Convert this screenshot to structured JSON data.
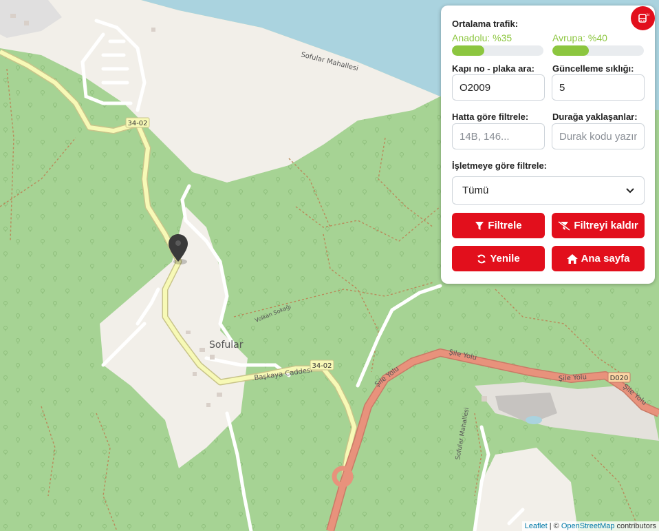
{
  "map": {
    "place_label": "Sofular",
    "neighborhood_label": "Sofular Mahallesi",
    "neighborhood_label_2": "Sofular Mahallesi",
    "road_badges": [
      "34-02",
      "34-02",
      "D020"
    ],
    "street_labels": {
      "baskaya": "Başkaya Caddesi",
      "volkan": "Volkan Sokağı",
      "sile1": "Şile Yolu",
      "sile2": "Şile Yolu",
      "sile3": "Şile Yolu",
      "sile4": "Şile Yolu"
    },
    "colors": {
      "forest": "#a6d394",
      "water": "#aad3df",
      "land": "#f2efe9",
      "primary_road": "#e8927c",
      "secondary_road": "#f7f9b6"
    }
  },
  "panel": {
    "traffic_title": "Ortalama trafik:",
    "anadolu_label": "Anadolu: %35",
    "anadolu_level": 0.35,
    "avrupa_label": "Avrupa: %40",
    "avrupa_level": 0.4,
    "door_label": "Kapı no - plaka ara:",
    "door_value": "O2009",
    "refresh_label": "Güncelleme sıklığı:",
    "refresh_value": "5",
    "line_filter_label": "Hatta göre filtrele:",
    "line_filter_placeholder": "14B, 146...",
    "stop_label": "Durağa yaklaşanlar:",
    "stop_placeholder": "Durak kodu yazın",
    "operator_label": "İşletmeye göre filtrele:",
    "operator_value": "Tümü",
    "filter_button": "Filtrele",
    "clear_filter_button": "Filtreyi kaldır",
    "refresh_button": "Yenile",
    "home_button": "Ana sayfa",
    "accent": "#e20f1c",
    "bar_color": "#8cc63f"
  },
  "attribution": {
    "leaflet": "Leaflet",
    "separator": " | © ",
    "osm": "OpenStreetMap",
    "contributors": " contributors"
  }
}
